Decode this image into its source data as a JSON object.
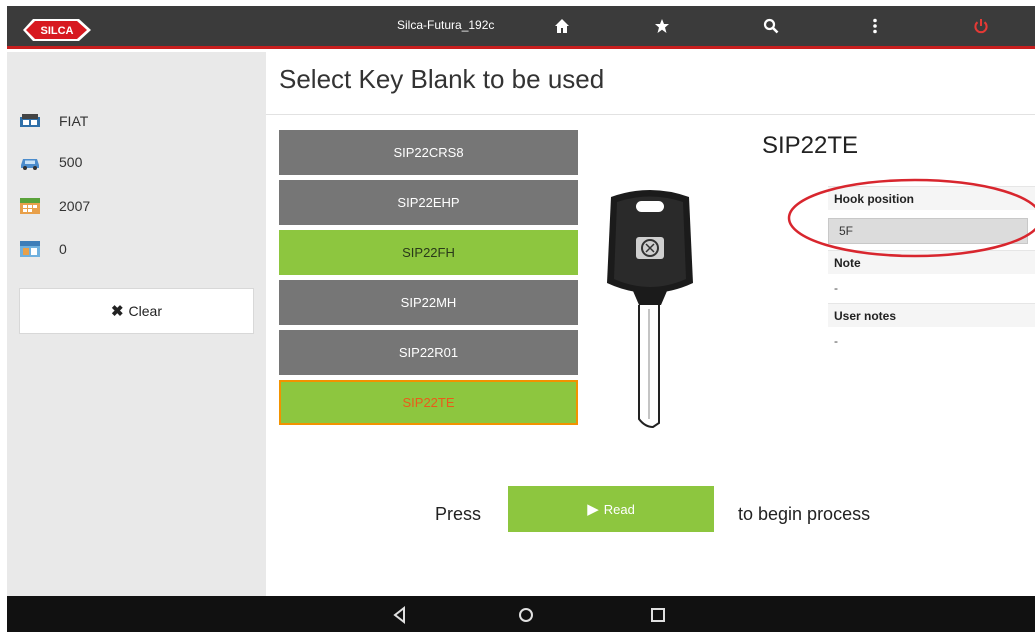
{
  "topbar": {
    "brand": "SILCA",
    "device_name": "Silca-Futura_192c",
    "icons": [
      "home-icon",
      "star-icon",
      "search-icon",
      "more-vertical-icon",
      "power-icon"
    ],
    "power_color": "#e53935"
  },
  "sidebar": {
    "items": [
      {
        "icon": "car-brand-icon",
        "label": "FIAT"
      },
      {
        "icon": "car-model-icon",
        "label": "500"
      },
      {
        "icon": "calendar-year-icon",
        "label": "2007"
      },
      {
        "icon": "calendar-count-icon",
        "label": "0"
      }
    ],
    "clear_label": "Clear"
  },
  "main": {
    "title": "Select Key Blank to be used",
    "key_blanks": [
      {
        "label": "SIP22CRS8",
        "state": "grey"
      },
      {
        "label": "SIP22EHP",
        "state": "grey"
      },
      {
        "label": "SIP22FH",
        "state": "green"
      },
      {
        "label": "SIP22MH",
        "state": "grey"
      },
      {
        "label": "SIP22R01",
        "state": "grey"
      },
      {
        "label": "SIP22TE",
        "state": "selected"
      }
    ],
    "selected_key": "SIP22TE",
    "details": {
      "hook_position_label": "Hook position",
      "hook_position_value": "5F",
      "note_label": "Note",
      "note_value": "-",
      "user_notes_label": "User notes",
      "user_notes_value": "-"
    },
    "press_text": "Press",
    "read_label": "Read",
    "begin_text": "to begin process",
    "accent_green": "#8dc63f",
    "selected_border": "#f29200"
  },
  "navbar": {
    "icons": [
      "back-icon",
      "home-circle-icon",
      "recents-icon"
    ]
  }
}
